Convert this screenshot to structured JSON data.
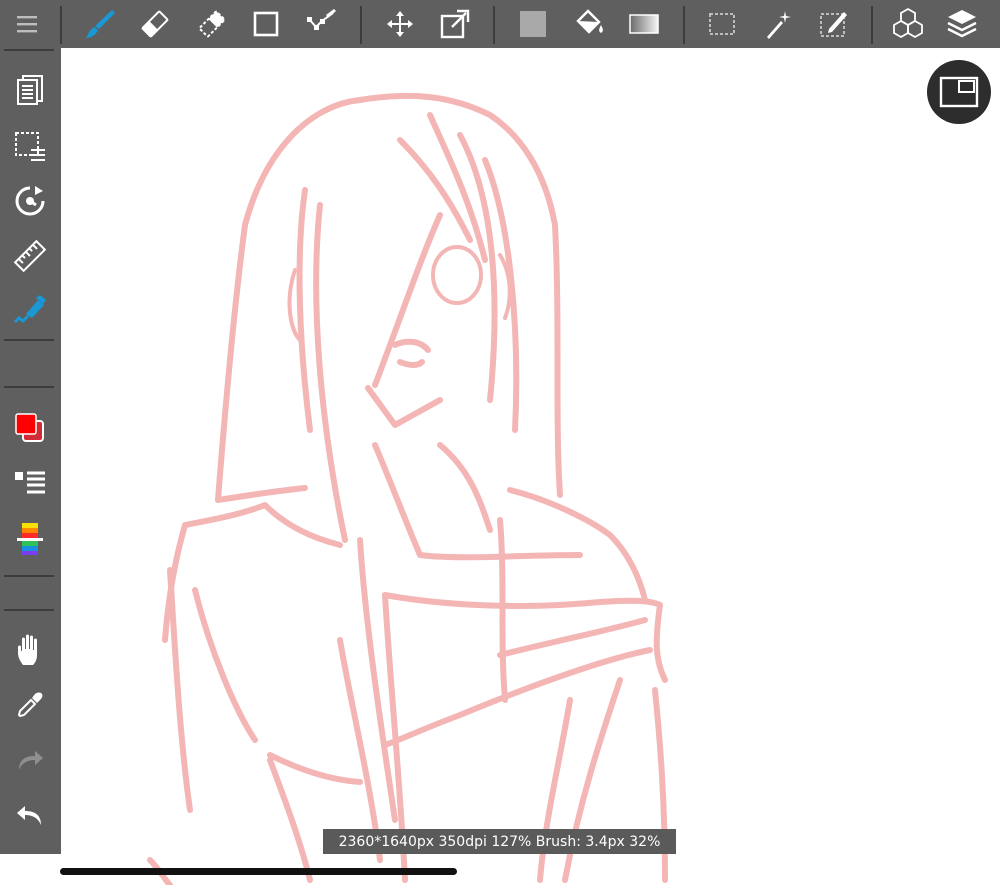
{
  "status_bar": {
    "text": "2360*1640px 350dpi 127% Brush: 3.4px 32%"
  },
  "colors": {
    "toolbar_bg": "#5f5f5f",
    "icon": "#ffffff",
    "active_tool": "#1a97d5",
    "primary_color": "#ff0000",
    "secondary_color": "#d22a36",
    "sketch_stroke": "#f0a0a0"
  },
  "toolbar": {
    "selected_tool": "brush",
    "tools": [
      "menu-icon",
      "brush-icon",
      "eraser-icon",
      "blur-icon",
      "rectangle-icon",
      "polyline-icon",
      "move-icon",
      "transform-icon",
      "fill-color-icon",
      "bucket-icon",
      "gradient-icon",
      "select-rect-icon",
      "magic-wand-icon",
      "select-pen-icon",
      "3d-model-icon",
      "layers-icon"
    ]
  },
  "sidebar": {
    "tools": [
      "pages-icon",
      "selection-menu-icon",
      "rotate-icon",
      "ruler-icon",
      "filter-icon",
      "color-icon",
      "brush-list-icon",
      "palette-icon",
      "hand-icon",
      "eyedropper-icon",
      "redo-icon",
      "undo-icon"
    ]
  }
}
